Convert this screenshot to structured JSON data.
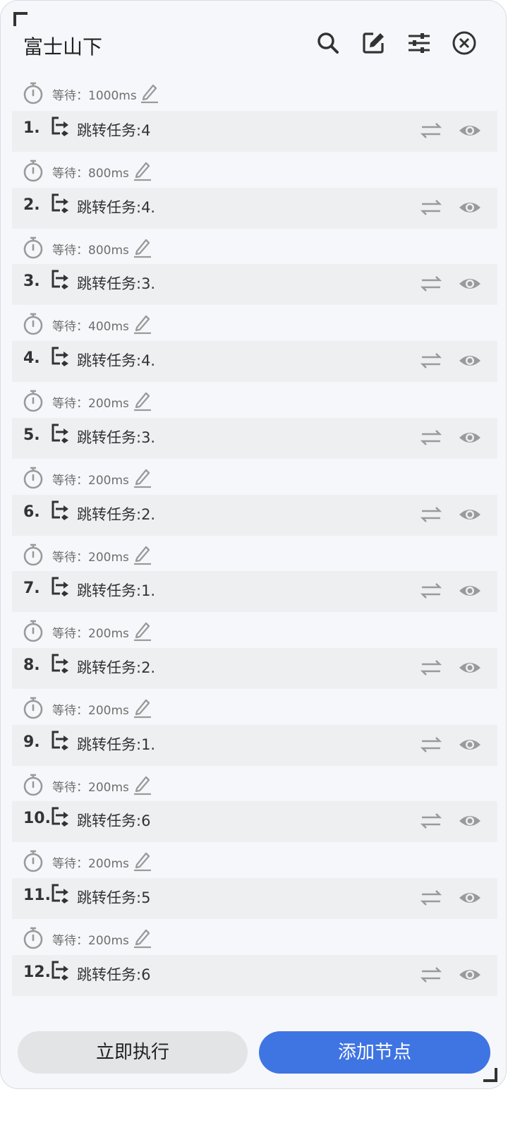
{
  "header": {
    "title": "富士山下",
    "icons": [
      "search-icon",
      "edit-square-icon",
      "filter-icon",
      "close-circle-icon"
    ]
  },
  "list": {
    "initial_wait": "等待：1000ms",
    "items": [
      {
        "num": "1.",
        "label": "跳转任务:4",
        "wait_after": "等待：800ms"
      },
      {
        "num": "2.",
        "label": "跳转任务:4.",
        "wait_after": "等待：800ms"
      },
      {
        "num": "3.",
        "label": "跳转任务:3.",
        "wait_after": "等待：400ms"
      },
      {
        "num": "4.",
        "label": "跳转任务:4.",
        "wait_after": "等待：200ms"
      },
      {
        "num": "5.",
        "label": "跳转任务:3.",
        "wait_after": "等待：200ms"
      },
      {
        "num": "6.",
        "label": "跳转任务:2.",
        "wait_after": "等待：200ms"
      },
      {
        "num": "7.",
        "label": "跳转任务:1.",
        "wait_after": "等待：200ms"
      },
      {
        "num": "8.",
        "label": "跳转任务:2.",
        "wait_after": "等待：200ms"
      },
      {
        "num": "9.",
        "label": "跳转任务:1.",
        "wait_after": "等待：200ms"
      },
      {
        "num": "10.",
        "label": "跳转任务:6",
        "wait_after": "等待：200ms"
      },
      {
        "num": "11.",
        "label": "跳转任务:5",
        "wait_after": "等待：200ms"
      },
      {
        "num": "12.",
        "label": "跳转任务:6",
        "wait_after": ""
      }
    ]
  },
  "footer": {
    "execute_label": "立即执行",
    "add_label": "添加节点"
  },
  "colors": {
    "accent": "#3f74e3",
    "row_bg": "#eeeff1",
    "panel_bg": "#f6f7fa",
    "icon_gray": "#9a9a9a"
  }
}
